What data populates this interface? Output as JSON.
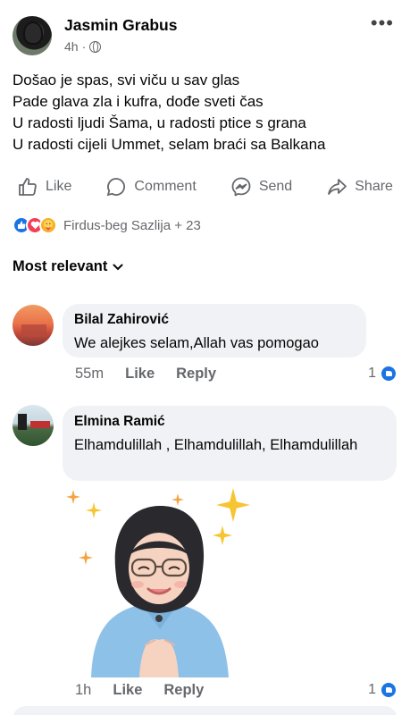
{
  "post": {
    "author": "Jasmin Grabus",
    "time": "4h",
    "lines": [
      "Došao je spas, svi viču u sav glas",
      "Pade glava zla i kufra, dođe sveti čas",
      "U radosti ljudi Šama, u radosti ptice s grana",
      "U radosti cijeli Ummet, selam braći sa Balkana"
    ]
  },
  "actions": {
    "like": "Like",
    "comment": "Comment",
    "send": "Send",
    "share": "Share"
  },
  "reactions": {
    "text": "Firdus-beg Sazlija + 23",
    "types": [
      "like-icon",
      "love-icon",
      "care-icon"
    ]
  },
  "sort": {
    "label": "Most relevant"
  },
  "comments": [
    {
      "name": "Bilal Zahirović",
      "text": "We alejkes selam,Allah vas pomogao",
      "time": "55m",
      "like": "Like",
      "reply": "Reply",
      "likes": "1"
    },
    {
      "name": "Elmina Ramić",
      "text": "Elhamdulillah , Elhamdulillah, Elhamdulillah",
      "time": "1h",
      "like": "Like",
      "reply": "Reply",
      "likes": "1"
    }
  ],
  "colors": {
    "like_blue": "#1b74e4",
    "love_red": "#f33e58",
    "bubble_bg": "#f0f2f5",
    "meta_gray": "#65676b"
  }
}
